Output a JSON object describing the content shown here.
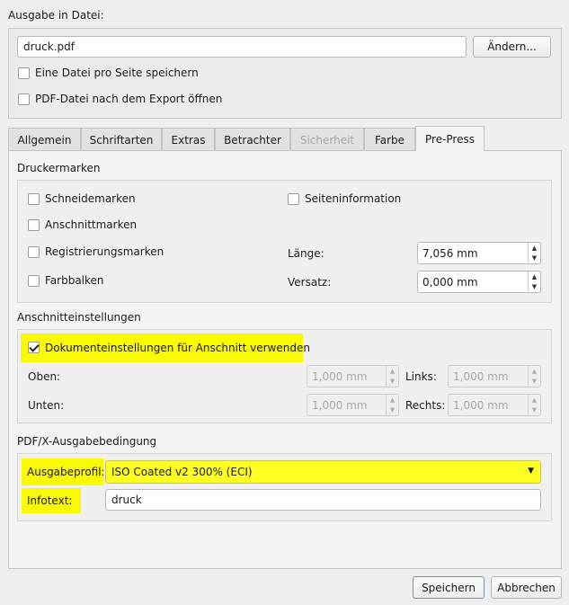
{
  "output": {
    "section_label": "Ausgabe in Datei:",
    "filename": "druck.pdf",
    "change_button": "Ändern...",
    "one_file_per_page": "Eine Datei pro Seite speichern",
    "open_after_export": "PDF-Datei nach dem Export öffnen"
  },
  "tabs": [
    {
      "label": "Allgemein",
      "state": "normal"
    },
    {
      "label": "Schriftarten",
      "state": "normal"
    },
    {
      "label": "Extras",
      "state": "normal"
    },
    {
      "label": "Betrachter",
      "state": "normal"
    },
    {
      "label": "Sicherheit",
      "state": "disabled"
    },
    {
      "label": "Farbe",
      "state": "normal"
    },
    {
      "label": "Pre-Press",
      "state": "active"
    }
  ],
  "printer_marks": {
    "title": "Druckermarken",
    "crop_marks": "Schneidemarken",
    "bleed_marks": "Anschnittmarken",
    "registration_marks": "Registrierungsmarken",
    "color_bars": "Farbbalken",
    "page_info": "Seiteninformation",
    "length_label": "Länge:",
    "length_value": "7,056 mm",
    "offset_label": "Versatz:",
    "offset_value": "0,000 mm"
  },
  "bleed": {
    "title": "Anschnitteinstellungen",
    "use_document_settings": "Dokumenteinstellungen für Anschnitt verwenden",
    "top_label": "Oben:",
    "top_value": "1,000 mm",
    "bottom_label": "Unten:",
    "bottom_value": "1,000 mm",
    "left_label": "Links:",
    "left_value": "1,000 mm",
    "right_label": "Rechts:",
    "right_value": "1,000 mm"
  },
  "pdfx": {
    "title": "PDF/X-Ausgabebedingung",
    "output_profile_label": "Ausgabeprofil:",
    "output_profile_value": "ISO Coated v2 300% (ECI)",
    "info_text_label": "Infotext:",
    "info_text_value": "druck"
  },
  "footer": {
    "save_button": "Speichern",
    "cancel_button": "Abbrechen"
  },
  "colors": {
    "highlight": "#fafa00",
    "default_button_border": "#6d8fc6"
  }
}
